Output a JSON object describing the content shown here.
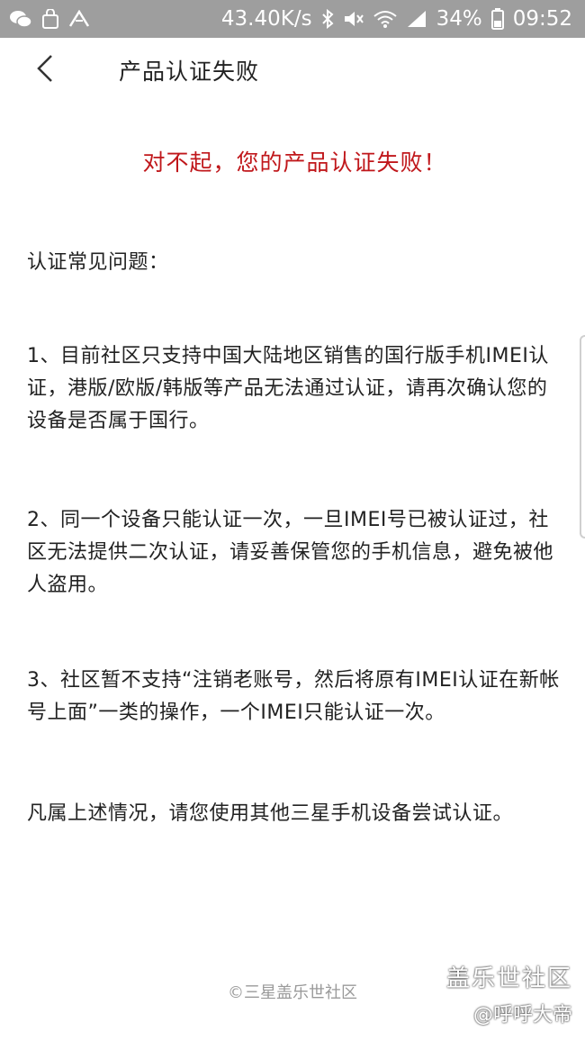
{
  "status_bar": {
    "network_speed": "43.40K/s",
    "battery_percent": "34%",
    "time": "09:52",
    "icons": [
      "wechat-icon",
      "bag-icon",
      "nav-icon",
      "bluetooth-icon",
      "mute-icon",
      "wifi-icon",
      "signal-icon",
      "battery-icon"
    ]
  },
  "header": {
    "title": "产品认证失败"
  },
  "main": {
    "headline": "对不起，您的产品认证失败！",
    "faq_title": "认证常见问题：",
    "items": [
      "1、目前社区只支持中国大陆地区销售的国行版手机IMEI认证，港版/欧版/韩版等产品无法通过认证，请再次确认您的设备是否属于国行。",
      "2、同一个设备只能认证一次，一旦IMEI号已被认证过，社区无法提供二次认证，请妥善保管您的手机信息，避免被他人盗用。",
      "3、社区暂不支持“注销老账号，然后将原有IMEI认证在新帐号上面”一类的操作，一个IMEI只能认证一次。"
    ],
    "closing": "凡属上述情况，请您使用其他三星手机设备尝试认证。"
  },
  "footer": {
    "copyright": "©三星盖乐世社区"
  },
  "watermark": {
    "brand": "盖乐世社区",
    "user": "@呼呼大帝"
  },
  "colors": {
    "status_bar_bg": "#9e9e9e",
    "headline_red": "#c0171b",
    "text": "#222222",
    "footer_gray": "#9a9a9a"
  }
}
